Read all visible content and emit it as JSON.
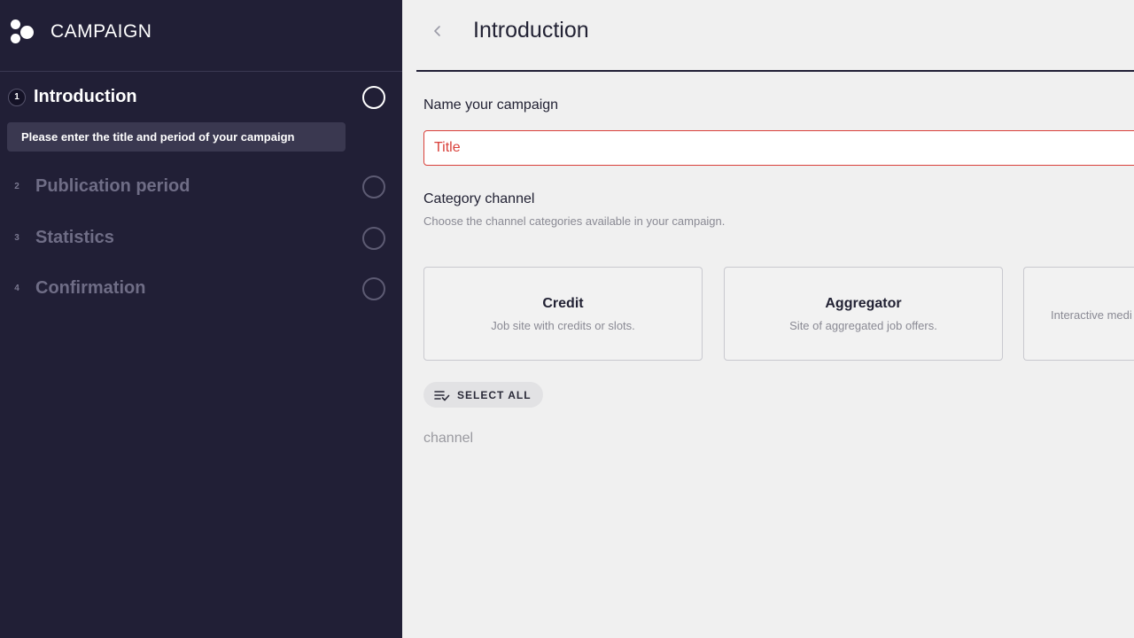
{
  "sidebar": {
    "brand_title": "CAMPAIGN",
    "steps": [
      {
        "number": "1",
        "label": "Introduction",
        "state": "active"
      },
      {
        "number": "2",
        "label": "Publication period",
        "state": "idle"
      },
      {
        "number": "3",
        "label": "Statistics",
        "state": "idle"
      },
      {
        "number": "4",
        "label": "Confirmation",
        "state": "idle"
      }
    ],
    "active_hint": "Please enter the title and period of your campaign"
  },
  "main": {
    "back_icon": "chevron-left-icon",
    "page_title": "Introduction",
    "name_section": {
      "label": "Name your campaign",
      "title_placeholder": "Title"
    },
    "category_section": {
      "label": "Category channel",
      "description": "Choose the channel categories available in your campaign."
    },
    "categories": [
      {
        "title": "Credit",
        "description": "Job site with credits or slots."
      },
      {
        "title": "Aggregator",
        "description": "Site of aggregated job offers."
      },
      {
        "title": "",
        "description": "Interactive medi"
      }
    ],
    "select_all_label": "SELECT ALL",
    "channel_label": "channel"
  },
  "colors": {
    "sidebar_bg": "#211f36",
    "main_bg": "#f0f0f0",
    "error": "#d9403a"
  }
}
